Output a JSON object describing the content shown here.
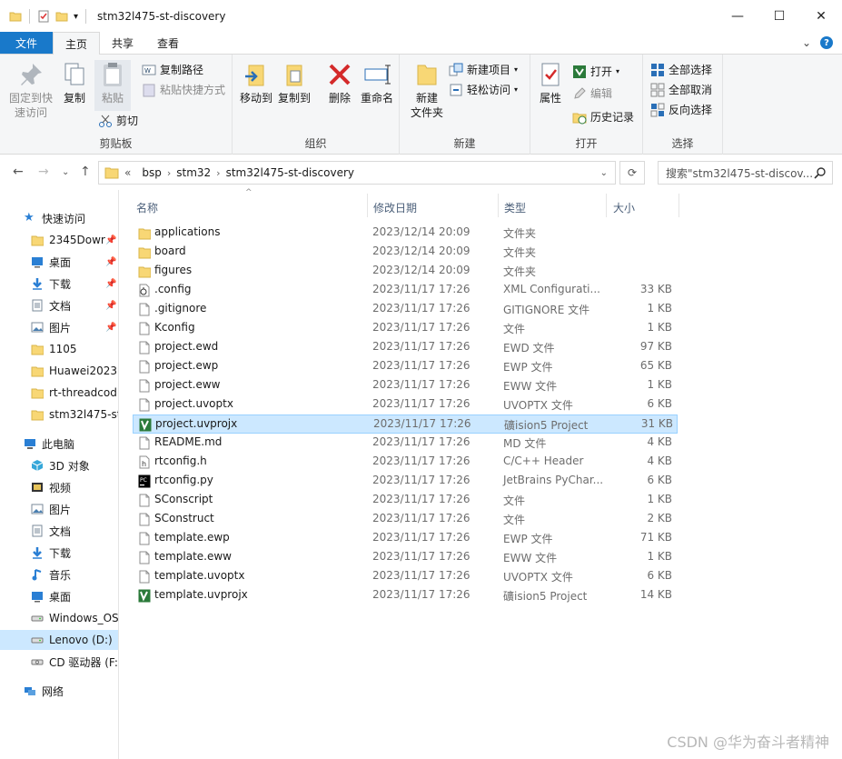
{
  "window": {
    "title": "stm32l475-st-discovery",
    "controls": {
      "minimize": "—",
      "maximize": "☐",
      "close": "✕"
    }
  },
  "tabs": [
    {
      "label": "文件",
      "kind": "file"
    },
    {
      "label": "主页",
      "kind": "active"
    },
    {
      "label": "共享",
      "kind": "normal"
    },
    {
      "label": "查看",
      "kind": "normal"
    }
  ],
  "ribbon": {
    "clipboard": {
      "label": "剪贴板",
      "pin_quick": "固定到快\n速访问",
      "copy": "复制",
      "paste": "粘贴",
      "copy_path": "复制路径",
      "paste_shortcut": "粘贴快捷方式",
      "cut": "剪切"
    },
    "organize": {
      "label": "组织",
      "move_to": "移动到",
      "copy_to": "复制到",
      "delete": "删除",
      "rename": "重命名"
    },
    "new": {
      "label": "新建",
      "new_folder": "新建\n文件夹",
      "new_item": "新建项目",
      "easy_access": "轻松访问"
    },
    "open": {
      "label": "打开",
      "properties": "属性",
      "open": "打开",
      "edit": "编辑",
      "history": "历史记录"
    },
    "select": {
      "label": "选择",
      "select_all": "全部选择",
      "select_none": "全部取消",
      "invert": "反向选择"
    }
  },
  "address": {
    "crumbs": [
      "«",
      "bsp",
      "stm32",
      "stm32l475-st-discovery"
    ],
    "search_placeholder": "搜索\"stm32l475-st-discov..."
  },
  "nav": {
    "quick_access": "快速访问",
    "quick_items": [
      {
        "label": "2345Dowr",
        "icon": "folder",
        "pinned": true
      },
      {
        "label": "桌面",
        "icon": "desktop",
        "pinned": true
      },
      {
        "label": "下载",
        "icon": "download",
        "pinned": true
      },
      {
        "label": "文档",
        "icon": "document",
        "pinned": true
      },
      {
        "label": "图片",
        "icon": "picture",
        "pinned": true
      },
      {
        "label": "1105",
        "icon": "folder",
        "pinned": false
      },
      {
        "label": "Huawei2023",
        "icon": "folder",
        "pinned": false
      },
      {
        "label": "rt-threadcod",
        "icon": "folder",
        "pinned": false
      },
      {
        "label": "stm32l475-st",
        "icon": "folder",
        "pinned": false
      }
    ],
    "this_pc": "此电脑",
    "pc_items": [
      {
        "label": "3D 对象",
        "icon": "3d"
      },
      {
        "label": "视频",
        "icon": "video"
      },
      {
        "label": "图片",
        "icon": "picture"
      },
      {
        "label": "文档",
        "icon": "document"
      },
      {
        "label": "下载",
        "icon": "download"
      },
      {
        "label": "音乐",
        "icon": "music"
      },
      {
        "label": "桌面",
        "icon": "desktop"
      },
      {
        "label": "Windows_OS",
        "icon": "drive"
      },
      {
        "label": "Lenovo (D:)",
        "icon": "drive",
        "selected": true
      },
      {
        "label": "CD 驱动器 (F:",
        "icon": "cd"
      }
    ],
    "network": "网络"
  },
  "columns": {
    "name": "名称",
    "date": "修改日期",
    "type": "类型",
    "size": "大小"
  },
  "files": [
    {
      "name": "applications",
      "date": "2023/12/14 20:09",
      "type": "文件夹",
      "size": "",
      "icon": "folder"
    },
    {
      "name": "board",
      "date": "2023/12/14 20:09",
      "type": "文件夹",
      "size": "",
      "icon": "folder"
    },
    {
      "name": "figures",
      "date": "2023/12/14 20:09",
      "type": "文件夹",
      "size": "",
      "icon": "folder"
    },
    {
      "name": ".config",
      "date": "2023/11/17 17:26",
      "type": "XML Configurati...",
      "size": "33 KB",
      "icon": "config"
    },
    {
      "name": ".gitignore",
      "date": "2023/11/17 17:26",
      "type": "GITIGNORE 文件",
      "size": "1 KB",
      "icon": "file"
    },
    {
      "name": "Kconfig",
      "date": "2023/11/17 17:26",
      "type": "文件",
      "size": "1 KB",
      "icon": "file"
    },
    {
      "name": "project.ewd",
      "date": "2023/11/17 17:26",
      "type": "EWD 文件",
      "size": "97 KB",
      "icon": "file"
    },
    {
      "name": "project.ewp",
      "date": "2023/11/17 17:26",
      "type": "EWP 文件",
      "size": "65 KB",
      "icon": "file"
    },
    {
      "name": "project.eww",
      "date": "2023/11/17 17:26",
      "type": "EWW 文件",
      "size": "1 KB",
      "icon": "file"
    },
    {
      "name": "project.uvoptx",
      "date": "2023/11/17 17:26",
      "type": "UVOPTX 文件",
      "size": "6 KB",
      "icon": "file"
    },
    {
      "name": "project.uvprojx",
      "date": "2023/11/17 17:26",
      "type": "礦ision5 Project",
      "size": "31 KB",
      "icon": "keil",
      "selected": true
    },
    {
      "name": "README.md",
      "date": "2023/11/17 17:26",
      "type": "MD 文件",
      "size": "4 KB",
      "icon": "file"
    },
    {
      "name": "rtconfig.h",
      "date": "2023/11/17 17:26",
      "type": "C/C++ Header",
      "size": "4 KB",
      "icon": "header"
    },
    {
      "name": "rtconfig.py",
      "date": "2023/11/17 17:26",
      "type": "JetBrains PyChar...",
      "size": "6 KB",
      "icon": "pycharm"
    },
    {
      "name": "SConscript",
      "date": "2023/11/17 17:26",
      "type": "文件",
      "size": "1 KB",
      "icon": "file"
    },
    {
      "name": "SConstruct",
      "date": "2023/11/17 17:26",
      "type": "文件",
      "size": "2 KB",
      "icon": "file"
    },
    {
      "name": "template.ewp",
      "date": "2023/11/17 17:26",
      "type": "EWP 文件",
      "size": "71 KB",
      "icon": "file"
    },
    {
      "name": "template.eww",
      "date": "2023/11/17 17:26",
      "type": "EWW 文件",
      "size": "1 KB",
      "icon": "file"
    },
    {
      "name": "template.uvoptx",
      "date": "2023/11/17 17:26",
      "type": "UVOPTX 文件",
      "size": "6 KB",
      "icon": "file"
    },
    {
      "name": "template.uvprojx",
      "date": "2023/11/17 17:26",
      "type": "礦ision5 Project",
      "size": "14 KB",
      "icon": "keil"
    }
  ],
  "watermark": "CSDN @华为奋斗者精神",
  "colors": {
    "accent": "#1979ca",
    "folder": "#f8d775",
    "selection": "#cce8ff"
  }
}
